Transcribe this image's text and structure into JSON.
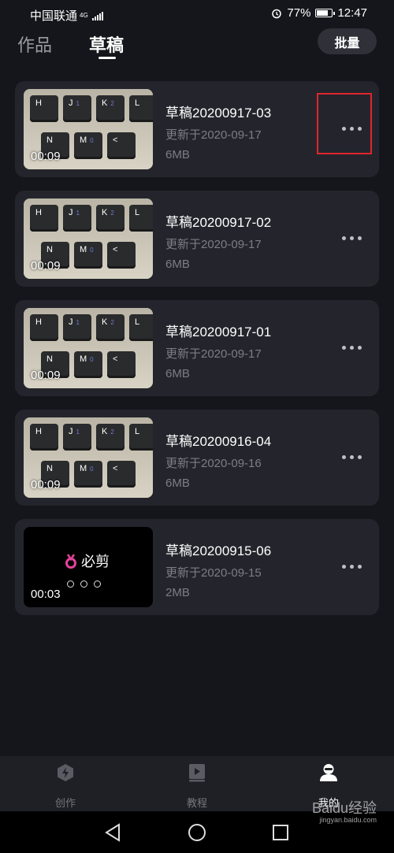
{
  "status": {
    "carrier": "中国联通",
    "network": "4G",
    "battery": "77%",
    "battery_level": 0.77,
    "time": "12:47"
  },
  "header": {
    "tabs": [
      {
        "label": "作品",
        "active": false
      },
      {
        "label": "草稿",
        "active": true
      }
    ],
    "batch_label": "批量"
  },
  "drafts": [
    {
      "title": "草稿20200917-03",
      "date": "更新于2020-09-17",
      "size": "6MB",
      "duration": "00:09",
      "thumb": "keyboard"
    },
    {
      "title": "草稿20200917-02",
      "date": "更新于2020-09-17",
      "size": "6MB",
      "duration": "00:09",
      "thumb": "keyboard"
    },
    {
      "title": "草稿20200917-01",
      "date": "更新于2020-09-17",
      "size": "6MB",
      "duration": "00:09",
      "thumb": "keyboard"
    },
    {
      "title": "草稿20200916-04",
      "date": "更新于2020-09-16",
      "size": "6MB",
      "duration": "00:09",
      "thumb": "keyboard"
    },
    {
      "title": "草稿20200915-06",
      "date": "更新于2020-09-15",
      "size": "2MB",
      "duration": "00:03",
      "thumb": "logo",
      "logo_text": "必剪"
    }
  ],
  "nav": [
    {
      "label": "创作",
      "icon": "lightning-icon",
      "active": false
    },
    {
      "label": "教程",
      "icon": "play-book-icon",
      "active": false
    },
    {
      "label": "我的",
      "icon": "profile-icon",
      "active": true
    }
  ],
  "watermark": {
    "text": "Baidu经验",
    "sub": "jingyan.baidu.com"
  },
  "colors": {
    "background": "#15161b",
    "card": "#24252c",
    "highlight": "#e0252b",
    "logo_pink": "#e3429a"
  },
  "keyboard_keys": [
    {
      "k": "H",
      "s": ""
    },
    {
      "k": "J",
      "s": "1"
    },
    {
      "k": "K",
      "s": "2"
    },
    {
      "k": "L",
      "s": ""
    },
    {
      "k": "N",
      "s": ""
    },
    {
      "k": "M",
      "s": "0"
    },
    {
      "k": "<",
      "s": ""
    }
  ]
}
